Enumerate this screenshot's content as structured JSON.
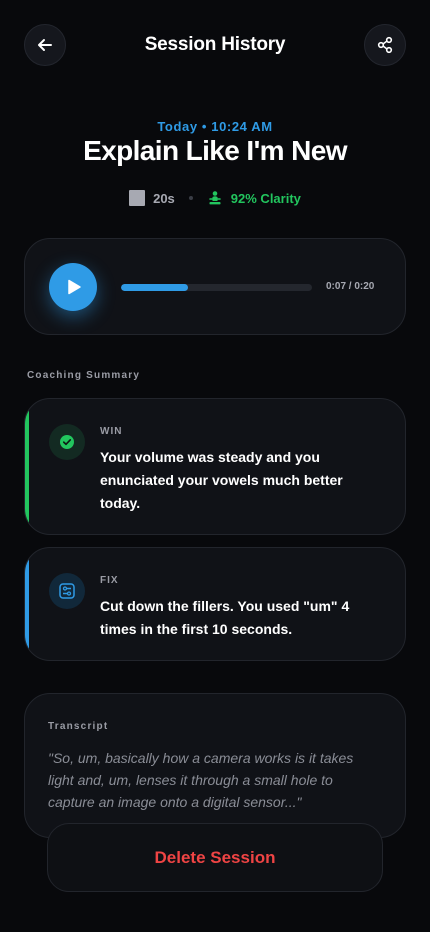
{
  "header": {
    "title": "Session History",
    "back_icon": "arrow-left-icon",
    "share_icon": "share-icon"
  },
  "session": {
    "date": "Today • 10:24 AM",
    "title": "Explain Like I'm New",
    "duration": "20s",
    "clarity": "92% Clarity",
    "clarity_color": "#22c55e"
  },
  "player": {
    "time": "0:07 / 0:20",
    "progress": 0.35,
    "accent": "#2f9be6"
  },
  "coaching": {
    "label": "Coaching Summary",
    "win": {
      "tag": "WIN",
      "text": "Your volume was steady and you enunciated your vowels much better today.",
      "icon": "check-circle-icon"
    },
    "fix": {
      "tag": "FIX",
      "text": "Cut down the fillers. You used \"um\" 4 times in the first 10 seconds.",
      "icon": "sliders-icon"
    }
  },
  "transcript": {
    "label": "Transcript",
    "text": "\"So, um, basically how a camera works is it takes light and, um, lenses it through a small hole to capture an image onto a digital sensor...\""
  },
  "actions": {
    "delete_label": "Delete Session",
    "delete_color": "#ef4444"
  }
}
